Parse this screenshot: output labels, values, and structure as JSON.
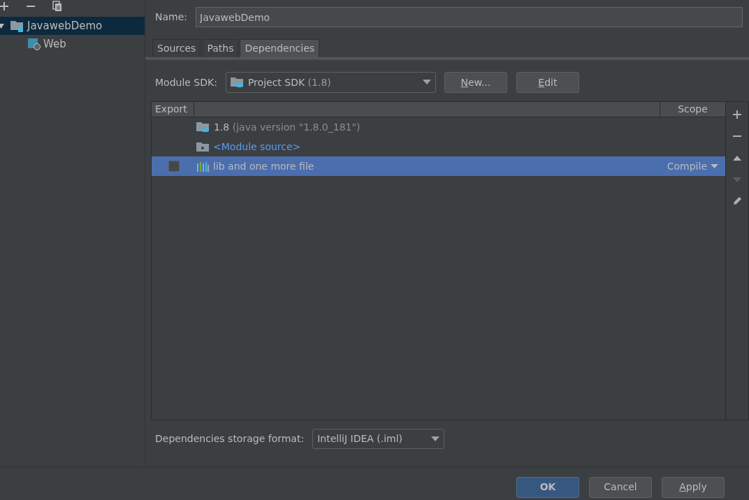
{
  "toolbar": {
    "buttons": [
      {
        "kind": "add"
      },
      {
        "kind": "remove"
      },
      {
        "kind": "copy"
      }
    ]
  },
  "tree": [
    {
      "label": "JavawebDemo",
      "kind": "module",
      "selected": true,
      "expanded": true,
      "children": [
        {
          "label": "Web",
          "kind": "web",
          "selected": false
        }
      ]
    }
  ],
  "name": {
    "label": "Name:",
    "value": "JavawebDemo"
  },
  "tabs": [
    {
      "label": "Sources",
      "selected": false
    },
    {
      "label": "Paths",
      "selected": false
    },
    {
      "label": "Dependencies",
      "selected": true
    }
  ],
  "module_sdk": {
    "label": "Module SDK:",
    "value": "Project SDK",
    "detail": "(1.8)",
    "buttons": [
      {
        "label": "New...",
        "underlined": true
      },
      {
        "label": "Edit",
        "underlined": true
      }
    ]
  },
  "table": {
    "columns": [
      "Export",
      "Scope"
    ],
    "rows": [
      {
        "kind": "sdk",
        "name": "1.8",
        "detail": "(java version \"1.8.0_181\")",
        "selected": false
      },
      {
        "kind": "source",
        "name": "<Module source>",
        "selected": false
      },
      {
        "kind": "library",
        "name": "lib and one more file",
        "checked": false,
        "scope": "Compile",
        "selected": true
      }
    ],
    "side_buttons": [
      {
        "kind": "add",
        "disabled": false
      },
      {
        "kind": "remove",
        "disabled": false
      },
      {
        "kind": "up",
        "disabled": false
      },
      {
        "kind": "down",
        "disabled": true
      },
      {
        "kind": "edit",
        "disabled": false
      }
    ]
  },
  "storage": {
    "label": "Dependencies storage format:",
    "value": "IntelliJ IDEA (.iml)"
  },
  "buttons": [
    {
      "label": "OK",
      "default": true,
      "underlined": false
    },
    {
      "label": "Cancel",
      "default": false,
      "underlined": false
    },
    {
      "label": "Apply",
      "default": false,
      "underlined": true
    }
  ]
}
